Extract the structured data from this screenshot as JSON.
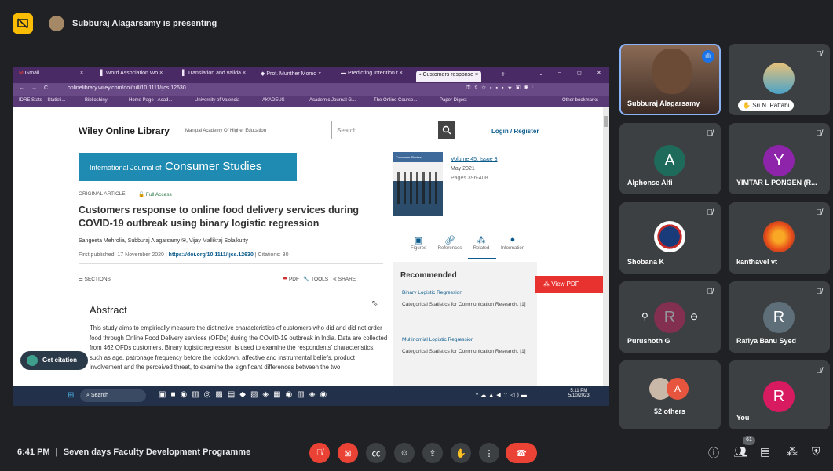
{
  "presenting": {
    "text": "Subburaj Alagarsamy is presenting"
  },
  "browser": {
    "tabs": [
      "Gmail",
      "Word Association Wo",
      "Translation and valida",
      "Prof. Munther Momo",
      "Predicting Intention t",
      "Customers response"
    ],
    "url": "onlinelibrary.wiley.com/doi/full/10.1111/ijcs.12630",
    "bookmarks": [
      "IDRE Stats – Statisti...",
      "Biblioshiny",
      "Home Page - Acad...",
      "University of Valencia",
      "AKADEUS",
      "Academic Journal G...",
      "The Online Course...",
      "Paper Digest",
      "Other bookmarks"
    ]
  },
  "wiley": {
    "logo": "Wiley Online Library",
    "institution": "Manipal Academy Of Higher Education",
    "search_placeholder": "Search",
    "login": "Login / Register",
    "journal_small": "International Journal of",
    "journal_big": "Consumer Studies",
    "article_type": "ORIGINAL ARTICLE",
    "full_access": "Full Access",
    "title": "Customers response to online food delivery services during COVID-19 outbreak using binary logistic regression",
    "authors": "Sangeeta Mehrolia, Subburaj Alagarsamy ✉, Vijay Mallikraj Solaikutty",
    "first_published_label": "First published: 17 November 2020 |",
    "doi": "https://doi.org/10.1111/ijcs.12630",
    "citations": "| Citations: 30",
    "sections": "SECTIONS",
    "pdf": "PDF",
    "tools": "TOOLS",
    "share": "SHARE",
    "abstract_title": "Abstract",
    "abstract_text": "This study aims to empirically measure the distinctive characteristics of customers who did and did not order food through Online Food Delivery services (OFDs) during the COVID-19 outbreak in India. Data are collected from 462 OFDs customers. Binary logistic regression is used to examine the respondents' characteristics, such as age, patronage frequency before the lockdown, affective and instrumental beliefs, product involvement and the perceived threat, to examine the significant differences between the two",
    "cover_title": "Consumer Studies",
    "volume": "Volume 45, Issue 3",
    "date": "May 2021",
    "pages": "Pages 396-408",
    "tabs": [
      "Figures",
      "References",
      "Related",
      "Information"
    ],
    "recommended": "Recommended",
    "rec1_link": "Binary Logistic Regression",
    "rec1_sub": "Categorical Statistics for Communication Research, [1]",
    "rec2_link": "Multinomial Logistic Regression",
    "rec2_sub": "Categorical Statistics for Communication Research, [1]",
    "view_pdf": "View PDF",
    "get_citation": "Get citation"
  },
  "taskbar": {
    "search": "Search",
    "time": "5:11 PM",
    "date": "5/10/2023"
  },
  "participants": {
    "p0": {
      "name": "Subburaj Alagarsamy"
    },
    "p1": {
      "name": "Sri N. Pattabi"
    },
    "p2": {
      "name": "Alphonse Alfi",
      "initial": "A",
      "color": "#1e6b5c"
    },
    "p3": {
      "name": "YIMTAR L PONGEN (R...",
      "initial": "Y",
      "color": "#8e24aa"
    },
    "p4": {
      "name": "Shobana K"
    },
    "p5": {
      "name": "kanthavel vt"
    },
    "p6": {
      "name": "Purushoth G",
      "initial": "R"
    },
    "p7": {
      "name": "Rafiya Banu Syed",
      "initial": "R",
      "color": "#5f6f7a"
    },
    "p8": {
      "name": "52 others",
      "initial": "A"
    },
    "p9": {
      "name": "You",
      "initial": "R",
      "color": "#d81b60"
    }
  },
  "meeting": {
    "time": "6:41 PM",
    "sep": "|",
    "title": "Seven days Faculty Development Programme",
    "participant_count": "61"
  }
}
